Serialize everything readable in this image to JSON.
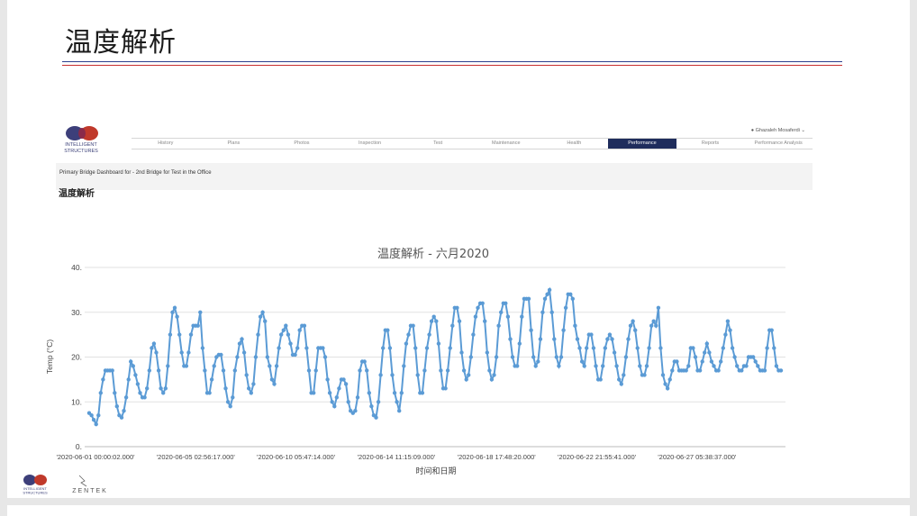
{
  "slide": {
    "title": "温度解析"
  },
  "app": {
    "logo_line1": "INTELLIGENT",
    "logo_line2": "STRUCTURES",
    "user": "Ghazaleh Mosaferdi",
    "nav": [
      "History",
      "Plans",
      "Photos",
      "Inspection",
      "Test",
      "Maintenance",
      "Health",
      "Performance",
      "Reports",
      "Performance Analysis"
    ],
    "active_nav": "Performance",
    "breadcrumb": "Primary Bridge Dashboard for - 2nd Bridge for Test in the Office",
    "page_heading": "温度解析"
  },
  "footer": {
    "logo1_line1": "INTELLIGENT",
    "logo1_line2": "STRUCTURES",
    "logo2": "ZENTEK"
  },
  "colors": {
    "series": "#5b9bd5",
    "rule_blue": "#2b3f8e",
    "rule_red": "#c62f2f",
    "nav_active": "#1f2d5c"
  },
  "chart_data": {
    "type": "line",
    "title": "温度解析 - 六月2020",
    "xlabel": "时间和日期",
    "ylabel": "Temp (°C)",
    "ylim": [
      0,
      40
    ],
    "yticks": [
      "0.",
      "10.",
      "20.",
      "30.",
      "40."
    ],
    "grid": true,
    "xtick_labels": [
      "'2020-06-01 00:00:02.000'",
      "'2020-06-05 02:56:17.000'",
      "'2020-06-10 05:47:14.000'",
      "'2020-06-14 11:15:09.000'",
      "'2020-06-18 17:48:20.000'",
      "'2020-06-22 21:55:41.000'",
      "'2020-06-27 05:38:37.000'"
    ],
    "series": [
      {
        "values": [
          7.5,
          7,
          6,
          5,
          7,
          12,
          15,
          17,
          17,
          17,
          17,
          12,
          9,
          7,
          6.5,
          8,
          11,
          15,
          19,
          18,
          16,
          14,
          12,
          11,
          11,
          13,
          17,
          22,
          23,
          21,
          17,
          13,
          12,
          13,
          18,
          25,
          30,
          31,
          29,
          25,
          21,
          18,
          18,
          21,
          25,
          27,
          27,
          27,
          30,
          22,
          17,
          12,
          12,
          15,
          18,
          20,
          20.5,
          20.5,
          17,
          13,
          10,
          9,
          11,
          17,
          20,
          23,
          24,
          21,
          16,
          13,
          12,
          14,
          20,
          25,
          29,
          30,
          28,
          20,
          18,
          15,
          14,
          18,
          22,
          25,
          26,
          27,
          25,
          23,
          20.5,
          20.5,
          22,
          26,
          27,
          27,
          22,
          17,
          12,
          12,
          17,
          22,
          22,
          22,
          20,
          15,
          12,
          10,
          9,
          11,
          13,
          15,
          15,
          14,
          10,
          8,
          7.5,
          8,
          11,
          17,
          19,
          19,
          17,
          12,
          9,
          7,
          6.5,
          10,
          16,
          22,
          26,
          26,
          22,
          16,
          12,
          10,
          8,
          12,
          18,
          23,
          25,
          27,
          27,
          22,
          16,
          12,
          12,
          17,
          22,
          25,
          28,
          29,
          28,
          23,
          17,
          13,
          13,
          17,
          22,
          27,
          31,
          31,
          28,
          21,
          17,
          15,
          16,
          20,
          25,
          29,
          31,
          32,
          32,
          28,
          21,
          17,
          15,
          16,
          20,
          27,
          30,
          32,
          32,
          29,
          24,
          20,
          18,
          18,
          23,
          29,
          33,
          33,
          33,
          26,
          20,
          18,
          19,
          24,
          30,
          33,
          34,
          35,
          30,
          24,
          20,
          18,
          20,
          26,
          31,
          34,
          34,
          33,
          27,
          24,
          22,
          19,
          18,
          22,
          25,
          25,
          22,
          18,
          15,
          15,
          18,
          22,
          24,
          25,
          24,
          21,
          18,
          15,
          14,
          16,
          20,
          24,
          27,
          28,
          26,
          22,
          18,
          16,
          16,
          18,
          22,
          27,
          28,
          27,
          31,
          22,
          16,
          14,
          13,
          15,
          17,
          19,
          19,
          17,
          17,
          17,
          17,
          18,
          22,
          22,
          20,
          17,
          17,
          19,
          21,
          23,
          21,
          19,
          18,
          17,
          17,
          19,
          22,
          25,
          28,
          26,
          22,
          20,
          18,
          17,
          17,
          18,
          18,
          20,
          20,
          20,
          19,
          18,
          17,
          17,
          17,
          22,
          26,
          26,
          22,
          18,
          17,
          17
        ]
      }
    ]
  }
}
